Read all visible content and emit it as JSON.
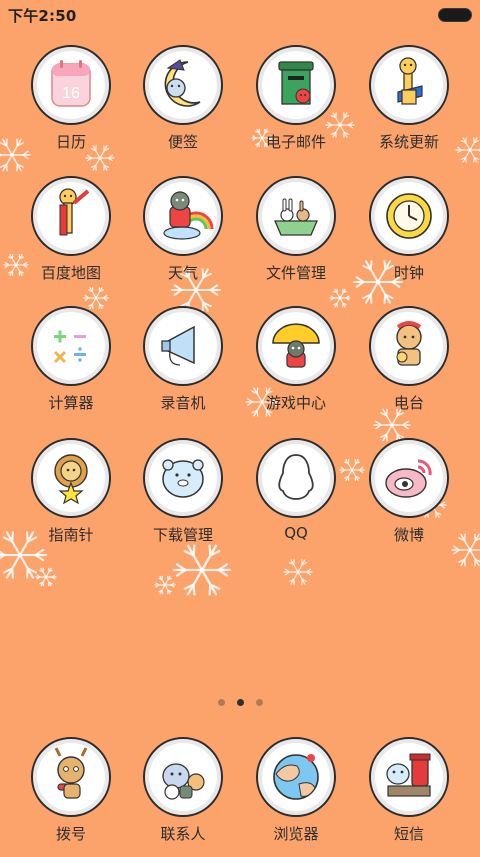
{
  "status_bar": {
    "time": "下午2:50"
  },
  "apps": [
    {
      "label": "日历",
      "icon": "calendar-icon",
      "value": "16"
    },
    {
      "label": "便签",
      "icon": "notes-moon-icon"
    },
    {
      "label": "电子邮件",
      "icon": "mail-postbox-icon"
    },
    {
      "label": "系统更新",
      "icon": "giraffe-guitar-icon"
    },
    {
      "label": "百度地图",
      "icon": "giraffe-map-icon"
    },
    {
      "label": "天气",
      "icon": "cat-rainbow-icon"
    },
    {
      "label": "文件管理",
      "icon": "bunnies-basket-icon"
    },
    {
      "label": "时钟",
      "icon": "clock-icon"
    },
    {
      "label": "计算器",
      "icon": "calculator-icon"
    },
    {
      "label": "录音机",
      "icon": "megaphone-icon"
    },
    {
      "label": "游戏中心",
      "icon": "cat-umbrella-icon"
    },
    {
      "label": "电台",
      "icon": "deer-radio-icon"
    },
    {
      "label": "指南针",
      "icon": "lion-star-icon"
    },
    {
      "label": "下载管理",
      "icon": "bear-download-icon"
    },
    {
      "label": "QQ",
      "icon": "penguin-outline-icon"
    },
    {
      "label": "微博",
      "icon": "weibo-eye-icon"
    }
  ],
  "dock": [
    {
      "label": "拨号",
      "icon": "deer-phone-icon"
    },
    {
      "label": "联系人",
      "icon": "friends-group-icon"
    },
    {
      "label": "浏览器",
      "icon": "globe-icon"
    },
    {
      "label": "短信",
      "icon": "bear-mailbox-icon"
    }
  ],
  "pager": {
    "count": 3,
    "active": 2
  },
  "colors": {
    "background": "#fca36c",
    "ring": "#e8e8e8",
    "label": "#2d2d2d"
  }
}
